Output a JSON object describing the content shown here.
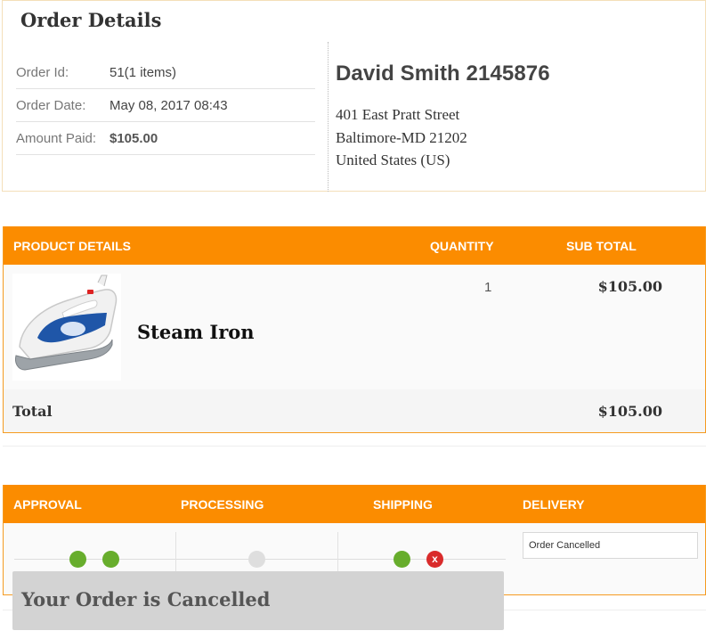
{
  "order": {
    "title": "Order Details",
    "rows": [
      {
        "label": "Order Id:",
        "value": "51(1 items)"
      },
      {
        "label": "Order Date:",
        "value": "May 08, 2017 08:43"
      },
      {
        "label": "Amount Paid:",
        "value": "$105.00"
      }
    ],
    "customer_name": "David Smith 2145876",
    "address": [
      "401 East Pratt Street",
      "Baltimore-MD 21202",
      "United States (US)"
    ]
  },
  "products": {
    "headers": {
      "product": "PRODUCT DETAILS",
      "quantity": "QUANTITY",
      "subtotal": "SUB TOTAL"
    },
    "items": [
      {
        "name": "Steam Iron",
        "image_icon": "steam-iron-icon",
        "quantity": "1",
        "subtotal": "$105.00"
      }
    ],
    "total_label": "Total",
    "total_value": "$105.00"
  },
  "tracking": {
    "headers": {
      "approval": "APPROVAL",
      "processing": "PROCESSING",
      "shipping": "SHIPPING",
      "delivery": "DELIVERY"
    },
    "delivery_status": "Order Cancelled",
    "cancel_icon": "x",
    "colors": {
      "complete": "#67ad2c",
      "pending": "#dedede",
      "cancelled": "#d92b2b",
      "accent": "#fb8c00"
    }
  },
  "banner": {
    "message": "Your Order is Cancelled"
  }
}
